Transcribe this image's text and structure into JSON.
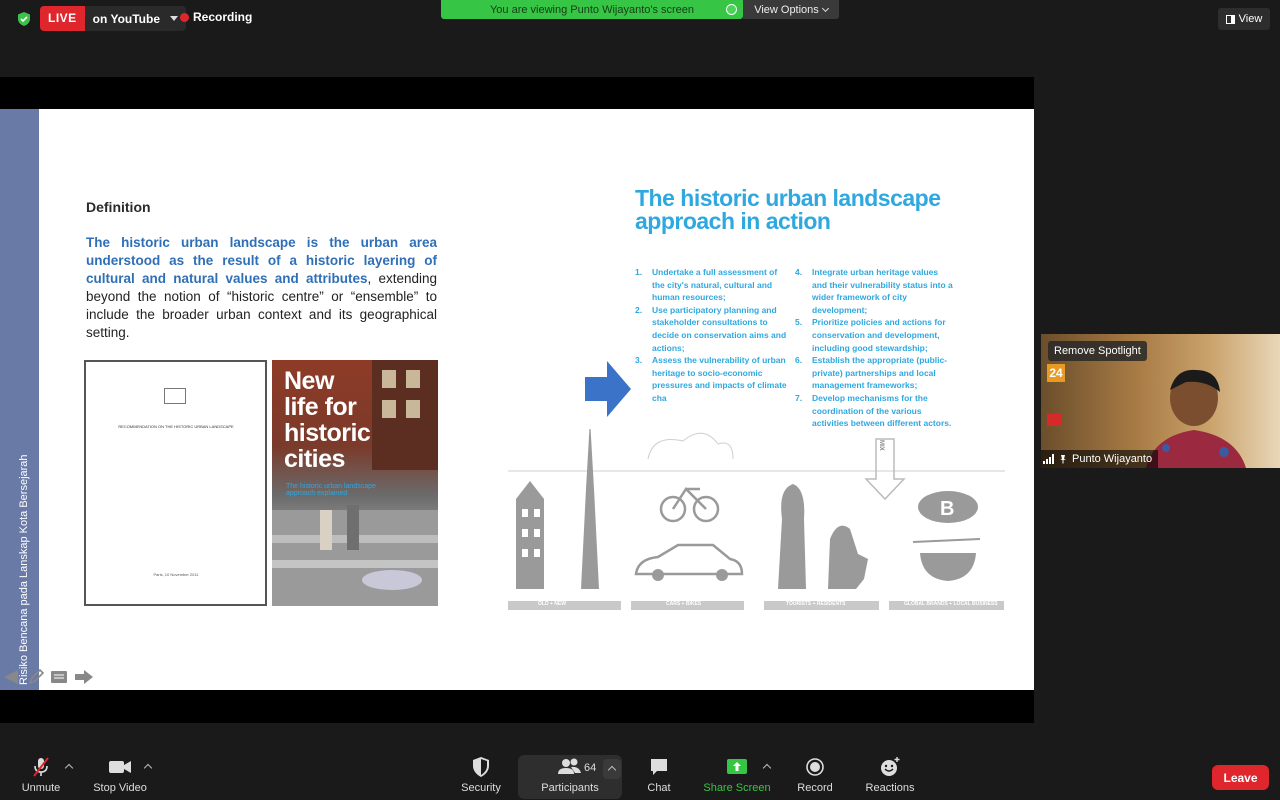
{
  "top_bar": {
    "live_badge": "LIVE",
    "live_target": "on YouTube",
    "recording_label": "Recording",
    "viewing_banner": "You are viewing Punto Wijayanto's screen",
    "view_options_label": "View Options",
    "view_label": "View"
  },
  "slide": {
    "side_strip_text": "Risiko Bencana pada Lanskap Kota Bersejarah",
    "definition_title": "Definition",
    "definition_highlight": "The historic urban landscape is the urban area understood as the result of a historic layering of cultural and natural values and attributes",
    "definition_rest": ", extending beyond the notion of “historic centre” or “ensemble” to include the broader urban context and its geographical setting.",
    "doc_title": "RECOMMENDATION ON THE HISTORIC URBAN LANDSCAPE",
    "doc_date": "Paris, 10 November 2011",
    "book_title_lines": [
      "New",
      "life for",
      "historic",
      "cities"
    ],
    "book_subtitle": "The historic urban landscape approach explained",
    "hul_title": "The historic urban landscape approach in action",
    "steps_col1": [
      {
        "num": "1.",
        "text": "Undertake a full assessment of the city's natural, cultural and human resources;"
      },
      {
        "num": "2.",
        "text": "Use participatory planning and stakeholder consultations to decide on conservation aims and actions;"
      },
      {
        "num": "3.",
        "text": "Assess the vulnerability of urban heritage to socio-economic pressures and impacts of climate cha"
      }
    ],
    "steps_col2": [
      {
        "num": "4.",
        "text": "Integrate urban heritage values and their vulnerability status into a wider framework of city development;"
      },
      {
        "num": "5.",
        "text": "Prioritize policies and actions for conservation and development, including good stewardship;"
      },
      {
        "num": "6.",
        "text": "Establish the appropriate (public-private) partnerships and local management frameworks;"
      },
      {
        "num": "7.",
        "text": "Develop mechanisms for the coordination of the various activities between different actors."
      }
    ],
    "illus_labels": [
      "OLD + NEW",
      "CARS + BIKES",
      "TOURISTS + RESIDENTS",
      "GLOBAL BRANDS + LOCAL BUSINESS"
    ],
    "mix_label": "MIX"
  },
  "video_tile": {
    "remove_spotlight_label": "Remove Spotlight",
    "participant_name": "Punto Wijayanto",
    "poster_day": "24"
  },
  "toolbar": {
    "unmute": "Unmute",
    "stop_video": "Stop Video",
    "security": "Security",
    "participants": "Participants",
    "participants_count": "64",
    "chat": "Chat",
    "share_screen": "Share Screen",
    "record": "Record",
    "reactions": "Reactions",
    "leave": "Leave"
  },
  "colors": {
    "accent_green": "#37c545",
    "live_red": "#e0262d",
    "slide_blue": "#2fa8e0",
    "definition_blue": "#2f6fb7"
  }
}
